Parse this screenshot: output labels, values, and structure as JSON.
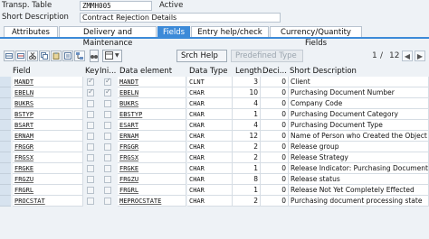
{
  "header": {
    "table_label": "Transp. Table",
    "table_name": "ZMMH005",
    "status": "Active",
    "desc_label": "Short Description",
    "description": "Contract Rejection Details"
  },
  "tabs": [
    {
      "label": "Attributes"
    },
    {
      "label": "Delivery and Maintenance"
    },
    {
      "label": "Fields"
    },
    {
      "label": "Entry help/check"
    },
    {
      "label": "Currency/Quantity Fields"
    }
  ],
  "toolbar": {
    "srch_help": "Srch Help",
    "predefined_type": "Predefined Type",
    "page_current": "1",
    "page_sep": "/",
    "page_total": "12"
  },
  "columns": [
    "Field",
    "Key",
    "Ini...",
    "Data element",
    "Data Type",
    "Length",
    "Deci...",
    "Short Description"
  ],
  "rows": [
    {
      "field": "MANDT",
      "key": true,
      "ini": true,
      "element": "MANDT",
      "type": "CLNT",
      "length": "3",
      "dec": "0",
      "desc": "Client"
    },
    {
      "field": "EBELN",
      "key": true,
      "ini": true,
      "element": "EBELN",
      "type": "CHAR",
      "length": "10",
      "dec": "0",
      "desc": "Purchasing Document Number"
    },
    {
      "field": "BUKRS",
      "key": false,
      "ini": false,
      "element": "BUKRS",
      "type": "CHAR",
      "length": "4",
      "dec": "0",
      "desc": "Company Code"
    },
    {
      "field": "BSTYP",
      "key": false,
      "ini": false,
      "element": "EBSTYP",
      "type": "CHAR",
      "length": "1",
      "dec": "0",
      "desc": "Purchasing Document Category"
    },
    {
      "field": "BSART",
      "key": false,
      "ini": false,
      "element": "ESART",
      "type": "CHAR",
      "length": "4",
      "dec": "0",
      "desc": "Purchasing Document Type"
    },
    {
      "field": "ERNAM",
      "key": false,
      "ini": false,
      "element": "ERNAM",
      "type": "CHAR",
      "length": "12",
      "dec": "0",
      "desc": "Name of Person who Created the Object"
    },
    {
      "field": "FRGGR",
      "key": false,
      "ini": false,
      "element": "FRGGR",
      "type": "CHAR",
      "length": "2",
      "dec": "0",
      "desc": "Release group"
    },
    {
      "field": "FRGSX",
      "key": false,
      "ini": false,
      "element": "FRGSX",
      "type": "CHAR",
      "length": "2",
      "dec": "0",
      "desc": "Release Strategy"
    },
    {
      "field": "FRGKE",
      "key": false,
      "ini": false,
      "element": "FRGKE",
      "type": "CHAR",
      "length": "1",
      "dec": "0",
      "desc": "Release Indicator: Purchasing Document"
    },
    {
      "field": "FRGZU",
      "key": false,
      "ini": false,
      "element": "FRGZU",
      "type": "CHAR",
      "length": "8",
      "dec": "0",
      "desc": "Release status"
    },
    {
      "field": "FRGRL",
      "key": false,
      "ini": false,
      "element": "FRGRL",
      "type": "CHAR",
      "length": "1",
      "dec": "0",
      "desc": "Release Not Yet Completely Effected"
    },
    {
      "field": "PROCSTAT",
      "key": false,
      "ini": false,
      "element": "MEPROCSTATE",
      "type": "CHAR",
      "length": "2",
      "dec": "0",
      "desc": "Purchasing document processing state"
    }
  ],
  "colors": {
    "accent": "#3c8ad8",
    "background": "#eef2f6"
  }
}
